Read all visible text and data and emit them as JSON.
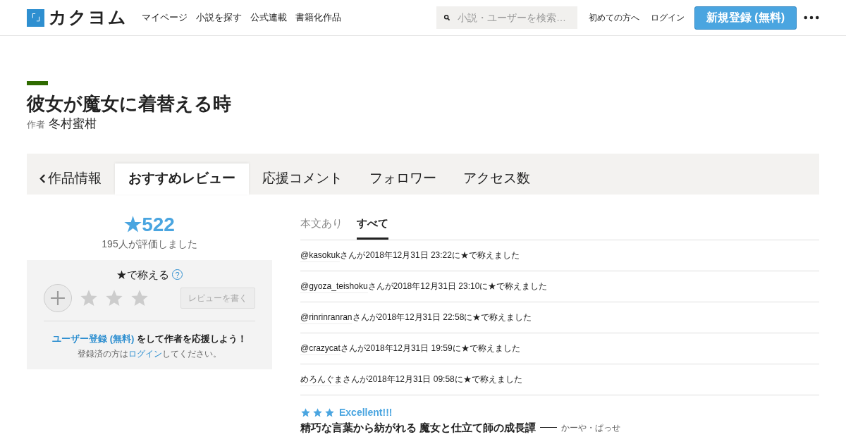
{
  "header": {
    "logo_mark": "「」",
    "logo_text": "カクヨム",
    "nav": [
      "マイページ",
      "小説を探す",
      "公式連載",
      "書籍化作品"
    ],
    "search": {
      "placeholder": "小説・ユーザーを検索…"
    },
    "links": [
      "初めての方へ",
      "ログイン"
    ],
    "signup_button": "新規登録 (無料)"
  },
  "work": {
    "title": "彼女が魔女に着替える時",
    "author_label": "作者",
    "author": "冬村蜜柑"
  },
  "tabs": [
    {
      "label": "作品情報",
      "kind": "back",
      "selected": false
    },
    {
      "label": "おすすめレビュー",
      "kind": "tab",
      "selected": true
    },
    {
      "label": "応援コメント",
      "kind": "tab",
      "selected": false
    },
    {
      "label": "フォロワー",
      "kind": "tab",
      "selected": false
    },
    {
      "label": "アクセス数",
      "kind": "tab",
      "selected": false
    }
  ],
  "summary": {
    "total": "★522",
    "raters": "195人が評価しました"
  },
  "rate_box": {
    "heading": "★で称える",
    "help": "?",
    "stars": 0,
    "review_button": "レビューを書く",
    "signup_link": "ユーザー登録 (無料)",
    "signup_text": "をして作者を応援しよう！",
    "login_pre": "登録済の方は",
    "login_link": "ログイン",
    "login_post": "してください。"
  },
  "filter_tabs": [
    {
      "label": "本文あり",
      "selected": false
    },
    {
      "label": "すべて",
      "selected": true
    }
  ],
  "praises": [
    {
      "user": "@kasokuk",
      "text": "さんが2018年12月31日 23:22に★で称えました"
    },
    {
      "user": "@gyoza_teishoku",
      "text": "さんが2018年12月31日 23:10に★で称えました"
    },
    {
      "user": "@rinrinranran",
      "text": "さんが2018年12月31日 22:58に★で称えました"
    },
    {
      "user": "@crazycat",
      "text": "さんが2018年12月31日 19:59に★で称えました"
    },
    {
      "user": "めろんぐま",
      "text": "さんが2018年12月31日 09:58に★で称えました"
    }
  ],
  "review": {
    "stars": 3,
    "headline": "Excellent!!!",
    "title": "精巧な言葉から紡がれる 魔女と仕立て師の成長譚",
    "author": "かーや・ぱっせ"
  }
}
